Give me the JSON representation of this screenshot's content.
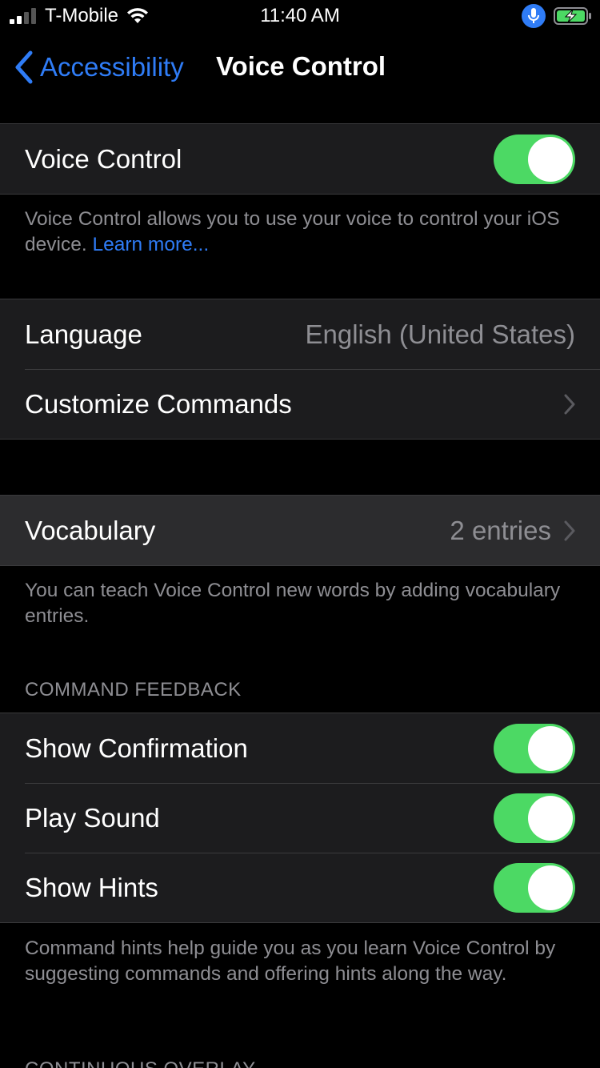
{
  "status_bar": {
    "carrier": "T-Mobile",
    "time": "11:40 AM",
    "signal_bars_filled": 2,
    "signal_bars_total": 4,
    "icons": [
      "wifi-icon",
      "microphone-icon",
      "battery-charging-icon"
    ]
  },
  "nav": {
    "back_label": "Accessibility",
    "title": "Voice Control"
  },
  "voice_control": {
    "label": "Voice Control",
    "enabled": true,
    "footer_text": "Voice Control allows you to use your voice to control your iOS device. ",
    "footer_link": "Learn more..."
  },
  "settings": {
    "language_label": "Language",
    "language_value": "English (United States)",
    "customize_label": "Customize Commands"
  },
  "vocabulary": {
    "label": "Vocabulary",
    "value": "2 entries",
    "footer_text": "You can teach Voice Control new words by adding vocabulary entries."
  },
  "command_feedback": {
    "header": "COMMAND FEEDBACK",
    "rows": [
      {
        "label": "Show Confirmation",
        "enabled": true
      },
      {
        "label": "Play Sound",
        "enabled": true
      },
      {
        "label": "Show Hints",
        "enabled": true
      }
    ],
    "footer_text": "Command hints help guide you as you learn Voice Control by suggesting commands and offering hints along the way."
  },
  "continuous_overlay": {
    "header": "CONTINUOUS OVERLAY"
  },
  "colors": {
    "accent": "#2f7cf6",
    "toggle_on": "#4cd964",
    "cell_bg": "#1c1c1e",
    "secondary_text": "#8e8e93"
  }
}
